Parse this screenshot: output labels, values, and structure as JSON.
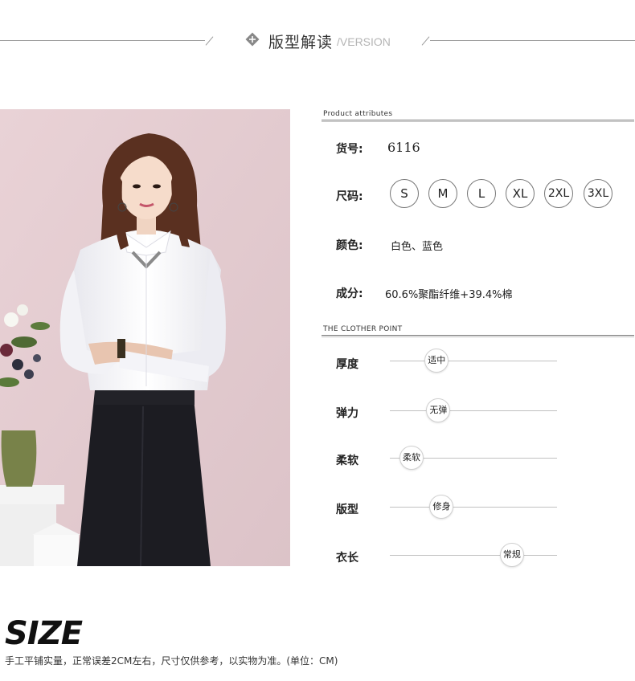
{
  "header": {
    "title": "版型解读",
    "subtitle": "/VERSION",
    "icon": "diamond-plus-icon"
  },
  "photo": {
    "description_icon": "model-photo"
  },
  "attributes": {
    "section_label": "Product attributes",
    "item_no": {
      "label": "货号:",
      "value": "6116"
    },
    "size": {
      "label": "尺码:",
      "options": [
        "S",
        "M",
        "L",
        "XL",
        "2XL",
        "3XL"
      ]
    },
    "color": {
      "label": "颜色:",
      "value": "白色、蓝色"
    },
    "material": {
      "label": "成分:",
      "value": "60.6%聚酯纤维+39.4%棉"
    }
  },
  "points": {
    "section_label": "THE CLOTHER POINT",
    "items": [
      {
        "label": "厚度",
        "value": "适中",
        "level": 0.28
      },
      {
        "label": "弹力",
        "value": "无弹",
        "level": 0.29
      },
      {
        "label": "柔软",
        "value": "柔软",
        "level": 0.13
      },
      {
        "label": "版型",
        "value": "修身",
        "level": 0.31
      },
      {
        "label": "衣长",
        "value": "常规",
        "level": 0.73
      }
    ]
  },
  "size_section": {
    "title": "SIZE",
    "note": "手工平铺实量，正常误差2CM左右，尺寸仅供参考，以实物为准。(单位：CM)"
  },
  "colors": {
    "accent_line": "#9a9a9a",
    "text": "#222222"
  }
}
